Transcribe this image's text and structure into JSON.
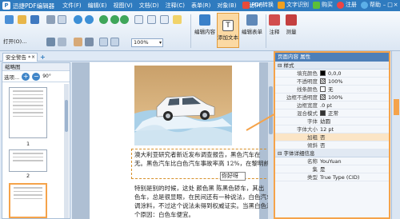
{
  "app": {
    "title": "迅捷PDF编辑器",
    "logo_text": "P",
    "menu": [
      "文件(F)",
      "编辑(E)",
      "视图(V)",
      "文档(D)",
      "注释(C)",
      "表单(R)",
      "对象(B)",
      "帮助(H)"
    ],
    "actions": [
      "PDF转换",
      "文字识别",
      "购买",
      "注册",
      "帮助"
    ],
    "action_colors": [
      "#e84b3c",
      "#f0a020",
      "#5bbf3a",
      "#e44",
      "#5cb0e8"
    ]
  },
  "toolbar": {
    "open_label": "打开(O)...",
    "zoom_value": "100%",
    "big_buttons": [
      "编辑内容",
      "添加文本",
      "编辑表单",
      "注释",
      "测量"
    ]
  },
  "tab": {
    "label": "安全警告 *",
    "close": "×",
    "add": "+"
  },
  "thumbs": {
    "title": "缩略图",
    "options": "选项...",
    "rotate": "90°",
    "pages": [
      "1",
      "2"
    ]
  },
  "doc": {
    "lines1": [
      "澳大利亚研究者新近发布调查报告，黑色汽车在",
      "无。黑色汽车比白色汽车事故率高 12%，在黎明前和晨"
    ],
    "highlight": "12%",
    "inserted_text": "你好呀",
    "lines2": [
      "特别是别的时候，这处 颜色黑  陈黑色轿车，其出",
      "色车，总是很显眼，在民间还有一种说法，白色汽车",
      "调涂料，不过这个说法未得到权威证实。当黑白色汽",
      "个原因：白色车便宜。"
    ]
  },
  "props": {
    "title": "页面内容 属性",
    "sections": [
      "样式",
      "字体详细信息"
    ],
    "style_rows": [
      {
        "k": "填充颜色",
        "v": "0,0,0",
        "swatch": "#000000"
      },
      {
        "k": "不透明度",
        "v": "100%",
        "swatch": "#666666"
      },
      {
        "k": "线条颜色",
        "v": "无",
        "swatch": "#ffffff"
      },
      {
        "k": "边框不透明度",
        "v": "100%",
        "swatch": "#666666"
      },
      {
        "k": "边框宽度",
        "v": ".0 pt",
        "swatch": ""
      },
      {
        "k": "混合模式",
        "v": "正常",
        "swatch": "#333333"
      },
      {
        "k": "字体",
        "v": "幼圆",
        "swatch": ""
      },
      {
        "k": "字体大小",
        "v": "12 pt",
        "swatch": ""
      },
      {
        "k": "加粗",
        "v": "否",
        "swatch": ""
      },
      {
        "k": "倾斜",
        "v": "否",
        "swatch": ""
      }
    ],
    "font_rows": [
      {
        "k": "名称",
        "v": "YouYuan"
      },
      {
        "k": "集",
        "v": "是"
      },
      {
        "k": "类型",
        "v": "True Type (CID)"
      }
    ]
  }
}
